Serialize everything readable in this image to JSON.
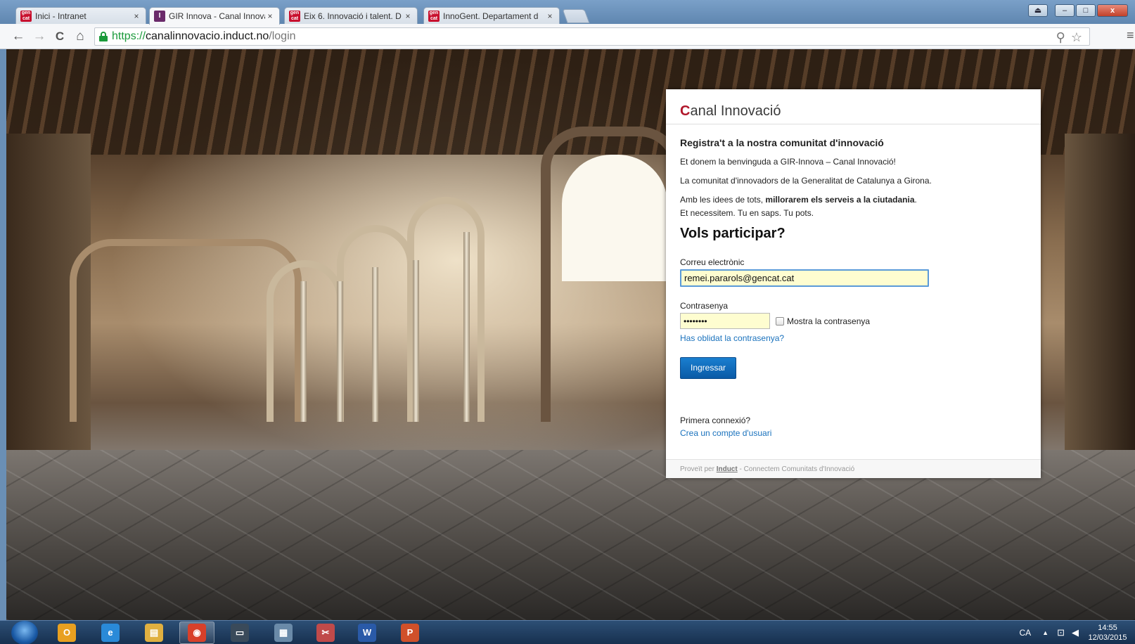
{
  "browser": {
    "tabs": [
      {
        "title": "Inici - Intranet",
        "favicon": "gencat-icon",
        "close": "×"
      },
      {
        "title": "GIR Innova - Canal Innova",
        "favicon": "induct-icon",
        "close": "×"
      },
      {
        "title": "Eix 6. Innovació i talent. D",
        "favicon": "gencat-icon",
        "close": "×"
      },
      {
        "title": "InnoGent. Departament d",
        "favicon": "gencat-icon",
        "close": "×"
      }
    ],
    "favicon_text": {
      "gencat": "gen cat",
      "induct": "I"
    },
    "window_controls": {
      "minimize": "–",
      "maximize": "□",
      "close": "x"
    },
    "nav": {
      "back": "←",
      "forward": "→",
      "reload": "C",
      "home": "⌂"
    },
    "url": {
      "scheme": "https://",
      "host": "canalinnovacio.induct.no",
      "path": "/login"
    },
    "omnibox_icons": {
      "extension": "⚲",
      "bookmark": "☆"
    },
    "menu": "≡"
  },
  "card": {
    "logo": {
      "first_letter": "C",
      "rest_first": "anal ",
      "innov": "Innovació"
    },
    "register_heading": "Registra't a la nostra comunitat d'innovació",
    "welcome": "Et donem la benvinguda a GIR-Innova – Canal Innovació!",
    "community": "La comunitat d'innovadors de la Generalitat de Catalunya a Girona.",
    "ideas_prefix": "Amb les idees de tots, ",
    "ideas_bold": "millorarem els serveis a la ciutadania",
    "ideas_suffix": ".",
    "need": "Et necessitem. Tu en saps. Tu pots.",
    "participate_heading": "Vols participar?",
    "email_label": "Correu electrònic",
    "email_value": "remei.pararols@gencat.cat",
    "password_label": "Contrasenya",
    "password_value": "••••••••",
    "show_password_label": "Mostra la contrasenya",
    "forgot_link": "Has oblidat la contrasenya?",
    "login_button": "Ingressar",
    "first_connection": "Primera connexió?",
    "create_account_link": "Crea un compte d'usuari",
    "footer_prefix": "Proveït per ",
    "footer_brand": "Induct",
    "footer_suffix": " - Connectem Comunitats d'Innovació"
  },
  "taskbar": {
    "items": [
      {
        "name": "outlook",
        "glyph": "O",
        "color": "#e8a020"
      },
      {
        "name": "internet-explorer",
        "glyph": "e",
        "color": "#2a8ad8"
      },
      {
        "name": "file-explorer",
        "glyph": "▤",
        "color": "#e0b040"
      },
      {
        "name": "chrome",
        "glyph": "◉",
        "color": "#d8402a"
      },
      {
        "name": "terminal",
        "glyph": "▭",
        "color": "#3a4a5a"
      },
      {
        "name": "calculator",
        "glyph": "▦",
        "color": "#6a8aa8"
      },
      {
        "name": "snipping-tool",
        "glyph": "✂",
        "color": "#c04a4a"
      },
      {
        "name": "word",
        "glyph": "W",
        "color": "#2a5aa8"
      },
      {
        "name": "powerpoint",
        "glyph": "P",
        "color": "#d0502a"
      }
    ],
    "language": "CA",
    "tray_arrow": "▲",
    "tray_icons": {
      "network": "⊡",
      "volume": "◀"
    },
    "time": "14:55",
    "date": "12/03/2015"
  }
}
